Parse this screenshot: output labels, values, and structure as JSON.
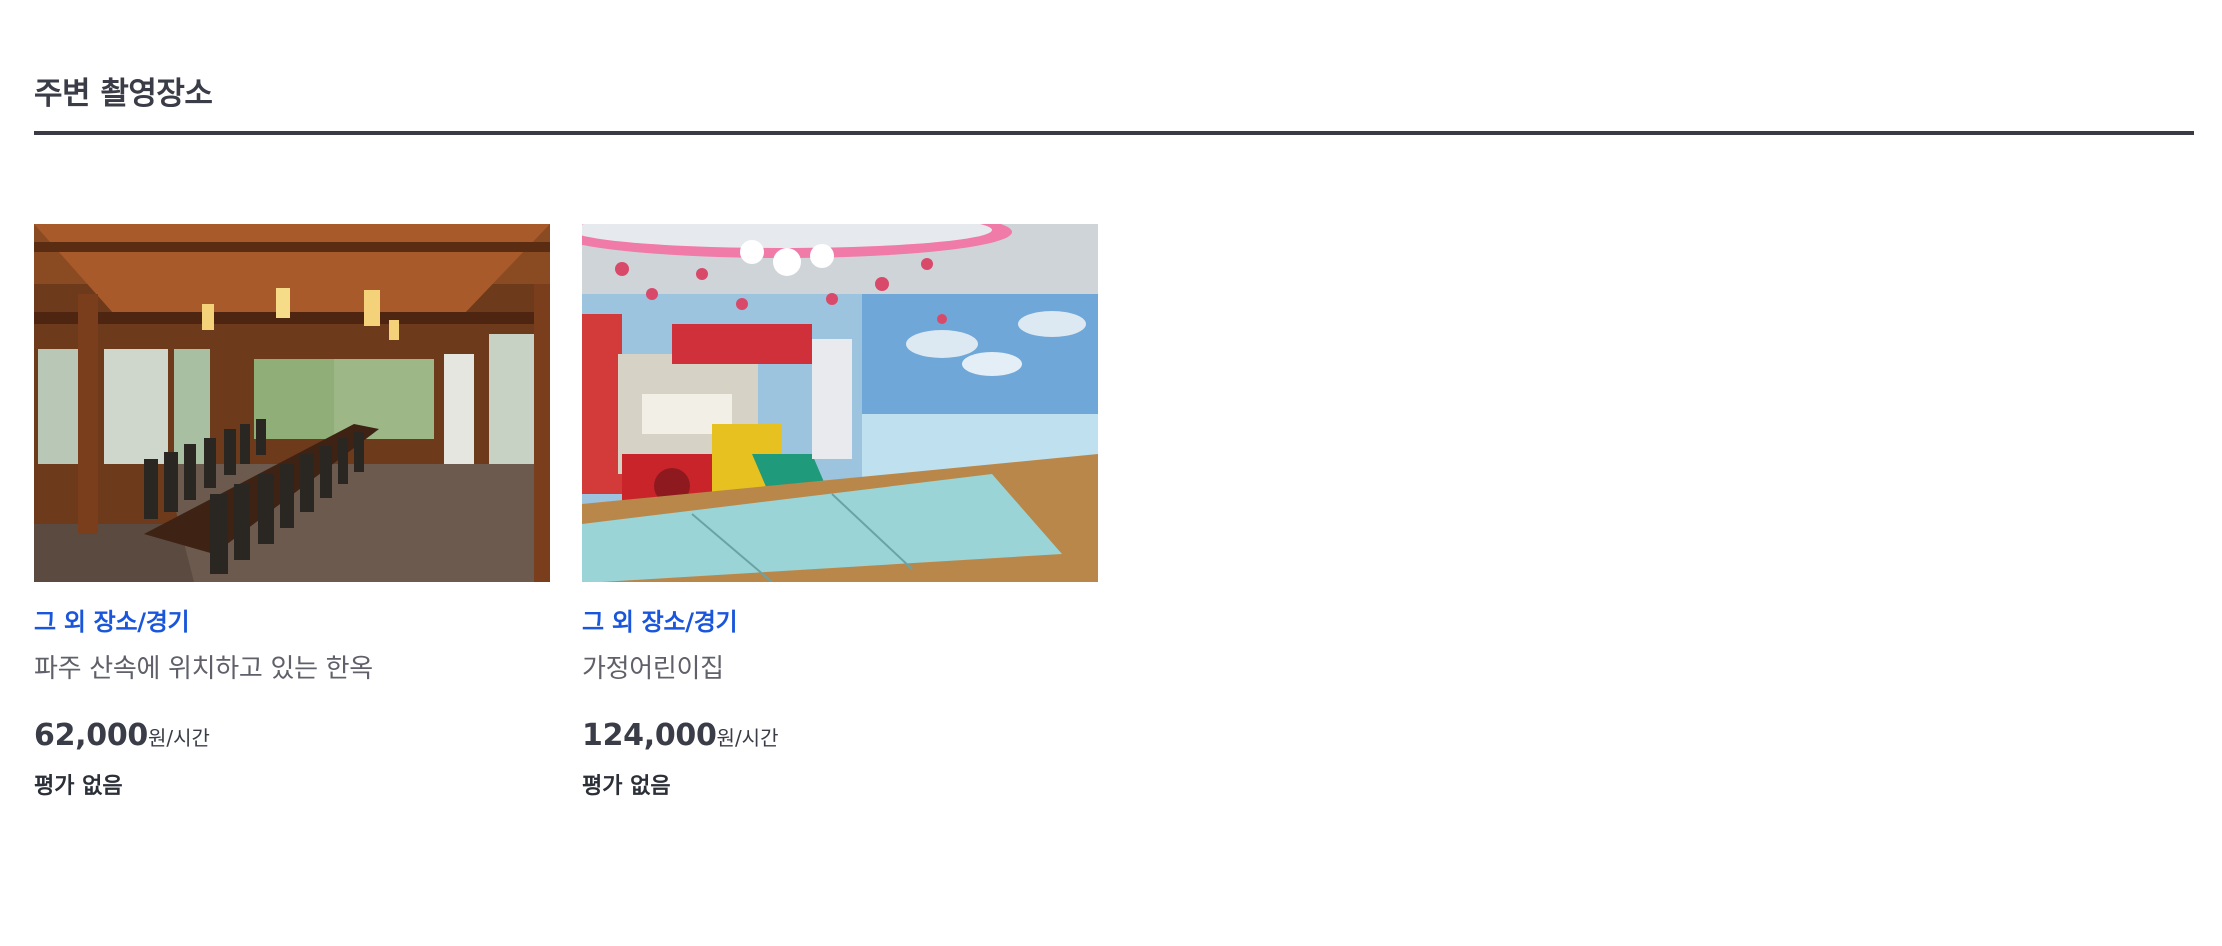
{
  "section": {
    "title": "주변 촬영장소"
  },
  "cards": [
    {
      "image_subject": "hanok interior with long wooden dining table",
      "category": "그 외 장소/경기",
      "title": "파주 산속에 위치하고 있는 한옥",
      "price": "62,000",
      "price_unit": "원/시간",
      "rating": "평가 없음"
    },
    {
      "image_subject": "children playroom with slide and dolphin mural",
      "category": "그 외 장소/경기",
      "title": "가정어린이집",
      "price": "124,000",
      "price_unit": "원/시간",
      "rating": "평가 없음"
    }
  ]
}
